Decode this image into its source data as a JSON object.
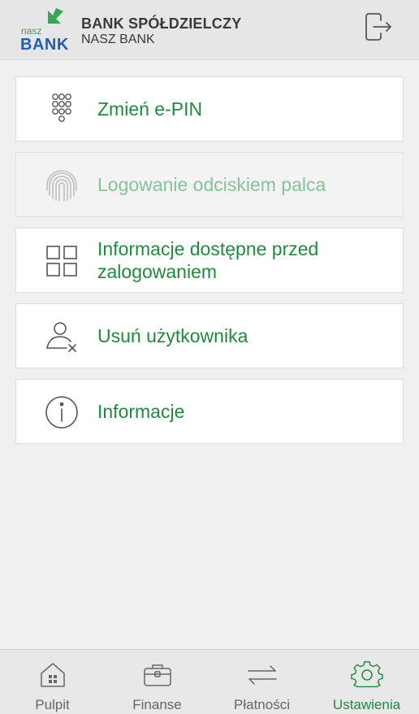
{
  "header": {
    "logo_top": "nasz",
    "logo_bottom": "BANK",
    "bank_name": "BANK SPÓŁDZIELCZY",
    "bank_sub": "NASZ BANK",
    "logout_icon": "logout-icon"
  },
  "menu": {
    "items": [
      {
        "label": "Zmień e-PIN",
        "icon": "keypad-icon",
        "enabled": true
      },
      {
        "label": "Logowanie odciskiem palca",
        "icon": "fingerprint-icon",
        "enabled": false
      },
      {
        "label": "Informacje dostępne przed zalogowaniem",
        "icon": "grid-icon",
        "enabled": true
      },
      {
        "label": "Usuń użytkownika",
        "icon": "remove-user-icon",
        "enabled": true
      },
      {
        "label": "Informacje",
        "icon": "info-icon",
        "enabled": true
      }
    ]
  },
  "tabs": [
    {
      "label": "Pulpit",
      "icon": "home-icon",
      "active": false
    },
    {
      "label": "Finanse",
      "icon": "briefcase-icon",
      "active": false
    },
    {
      "label": "Płatności",
      "icon": "transfer-arrows-icon",
      "active": false
    },
    {
      "label": "Ustawienia",
      "icon": "gear-icon",
      "active": true
    }
  ],
  "colors": {
    "accent": "#1f8a3f",
    "accent_disabled": "#86c39a",
    "logo_blue": "#1f5fae",
    "logo_green": "#34a853",
    "header_bg": "#e6e6e6",
    "page_bg": "#f0f0f0"
  }
}
